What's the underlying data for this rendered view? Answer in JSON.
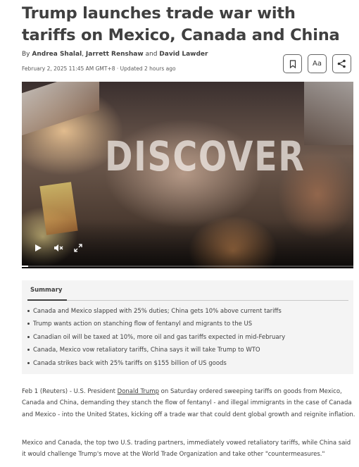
{
  "article": {
    "headline": "Trump launches trade war with tariffs on Mexico, Canada and China",
    "byline_prefix": "By",
    "authors": [
      "Andrea Shalal",
      "Jarrett Renshaw",
      "David Lawder"
    ],
    "byline_sep1": ", ",
    "byline_sep2": " and ",
    "dateline": "February 2, 2025 11:45 AM GMT+8 · Updated 2 hours ago"
  },
  "toolbar": {
    "bookmark_icon": "bookmark-icon",
    "text_size_label": "Aa",
    "share_icon": "share-icon"
  },
  "video": {
    "overlay_text": "DISCOVER",
    "progress": 0.02
  },
  "summary": {
    "tab_label": "Summary",
    "items": [
      "Canada and Mexico slapped with 25% duties; China gets 10% above current tariffs",
      "Trump wants action on stanching flow of fentanyl and migrants to the US",
      "Canadian oil will be taxed at 10%, more oil and gas tariffs expected in mid-February",
      "Canada, Mexico vow retaliatory tariffs, China says it will take Trump to WTO",
      "Canada strikes back with 25% tariffs on $155 billion of US goods"
    ]
  },
  "body": {
    "p1_before_link": "Feb 1 (Reuters) - U.S. President ",
    "p1_link": "Donald Trump",
    "p1_after_link": " on Saturday ordered sweeping tariffs on goods from Mexico, Canada and China, demanding they stanch the flow of fentanyl - and illegal immigrants in the case of Canada and Mexico - into the United States, kicking off a trade war that could dent global growth and reignite inflation.",
    "p2": "Mexico and Canada, the top two U.S. trading partners, immediately vowed retaliatory tariffs, while China said it would challenge Trump's move at the World Trade Organization and take other \"countermeasures.\""
  }
}
